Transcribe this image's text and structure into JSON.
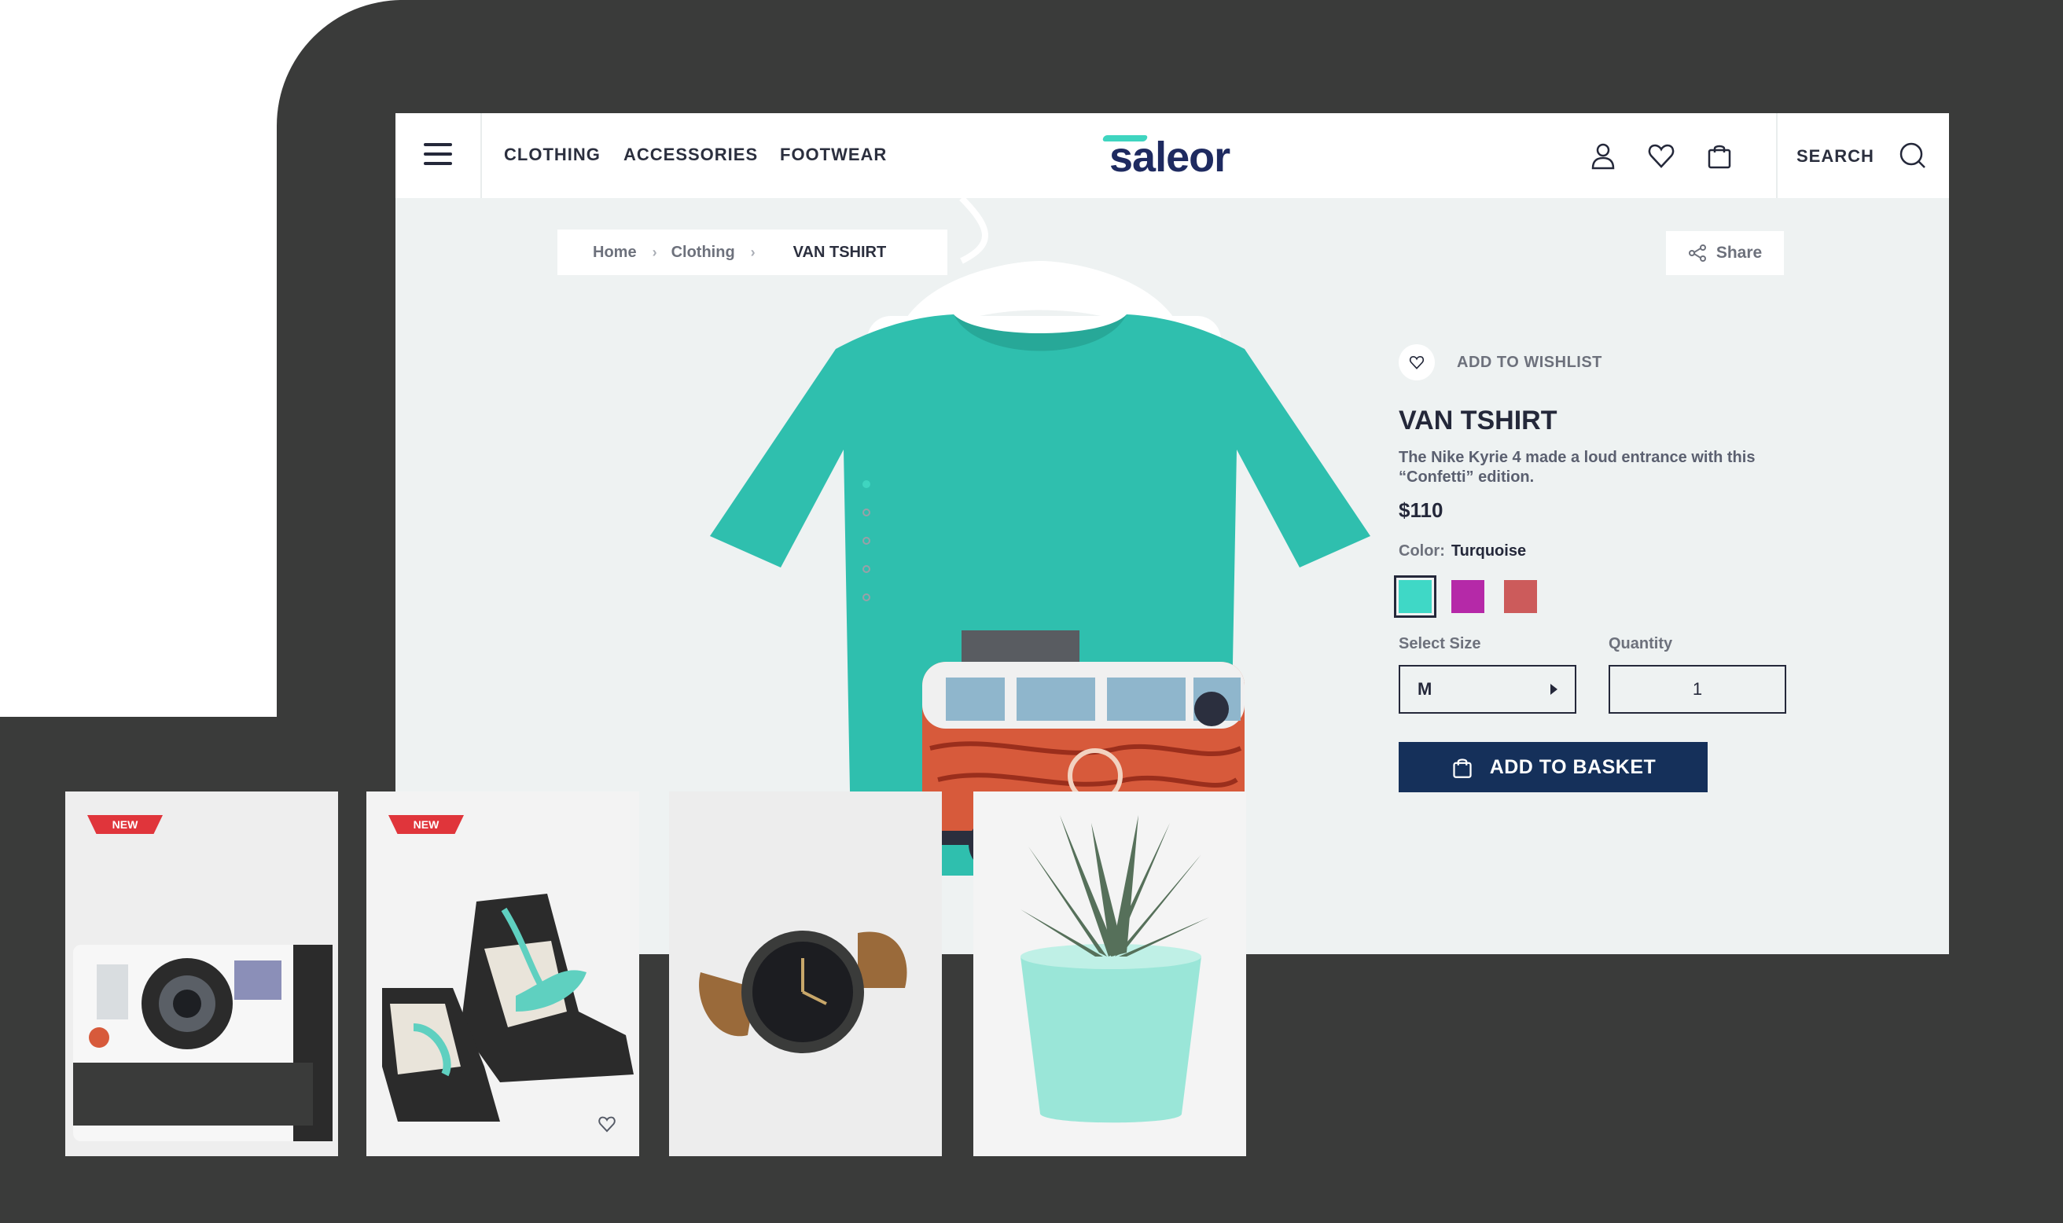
{
  "brand": {
    "logo_text": "saleor",
    "accent_color": "#3fd5c0",
    "primary_color": "#15305a"
  },
  "header": {
    "menu_icon": "hamburger-menu-icon",
    "nav": [
      {
        "label": "CLOTHING"
      },
      {
        "label": "ACCESSORIES"
      },
      {
        "label": "FOOTWEAR"
      }
    ],
    "icons": [
      "user-icon",
      "heart-icon",
      "shopping-bag-icon"
    ],
    "search_label": "SEARCH",
    "search_icon": "search-icon"
  },
  "breadcrumb": {
    "items": [
      "Home",
      "Clothing"
    ],
    "current": "VAN TSHIRT"
  },
  "share": {
    "label": "Share",
    "icon": "share-icon"
  },
  "gallery": {
    "image_count": 5,
    "active_index": 0
  },
  "product": {
    "wishlist_label": "ADD TO WISHLIST",
    "title": "VAN TSHIRT",
    "description": "The Nike Kyrie 4 made a loud entrance with this “Confetti” edition.",
    "price": "$110",
    "color_label": "Color:",
    "color_value": "Turquoise",
    "colors": [
      {
        "name": "Turquoise",
        "hex": "#3fd8c6",
        "selected": true
      },
      {
        "name": "Purple",
        "hex": "#b529a8",
        "selected": false
      },
      {
        "name": "Red",
        "hex": "#cc5b5b",
        "selected": false
      }
    ],
    "size_label": "Select Size",
    "size_value": "M",
    "quantity_label": "Quantity",
    "quantity_value": "1",
    "add_to_basket_label": "ADD TO BASKET"
  },
  "cards": [
    {
      "item": "instant-camera",
      "badge": "NEW"
    },
    {
      "item": "sneakers",
      "badge": "NEW",
      "heart_icon": "heart-icon"
    },
    {
      "item": "wristwatch",
      "badge": ""
    },
    {
      "item": "potted-succulent",
      "badge": ""
    }
  ]
}
